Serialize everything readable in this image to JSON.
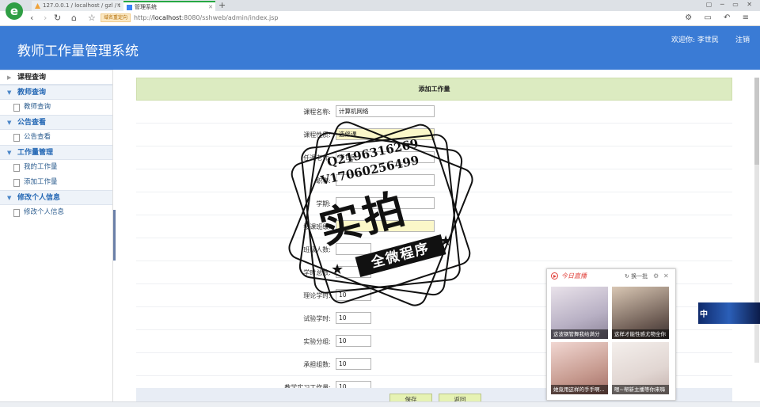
{
  "browser": {
    "tabs": [
      {
        "label": "127.0.0.1 / localhost / gzl / t"
      },
      {
        "label": "管理系统"
      }
    ],
    "new_tab": "+",
    "address_tag": "域名重定向",
    "address_scheme": "http://",
    "address_host": "localhost",
    "address_path": ":8080/sshweb/admin/index.jsp"
  },
  "header": {
    "title": "教师工作量管理系统",
    "welcome": "欢迎你: 李世民",
    "logout": "注销"
  },
  "sidebar": {
    "sections": [
      {
        "label": "课程查询",
        "items": []
      },
      {
        "label": "教师查询",
        "items": [
          {
            "label": "教师查询"
          }
        ]
      },
      {
        "label": "公告查看",
        "items": [
          {
            "label": "公告查看"
          }
        ]
      },
      {
        "label": "工作量管理",
        "items": [
          {
            "label": "我的工作量"
          },
          {
            "label": "添加工作量"
          }
        ]
      },
      {
        "label": "修改个人信息",
        "items": [
          {
            "label": "修改个人信息"
          }
        ]
      }
    ]
  },
  "form": {
    "title": "添加工作量",
    "fields": [
      {
        "label": "课程名称:",
        "value": "计算机网络"
      },
      {
        "label": "课程性质:",
        "value": "选修课"
      },
      {
        "label": "任课老师:",
        "value": "李世民"
      },
      {
        "label": "职称:",
        "value": ""
      },
      {
        "label": "学期:",
        "value": ""
      },
      {
        "label": "授课班级:",
        "value": ""
      },
      {
        "label": "班级人数:",
        "value": ""
      },
      {
        "label": "学时总数:",
        "value": ""
      },
      {
        "label": "理论学时:",
        "value": "10"
      },
      {
        "label": "试验学时:",
        "value": "10"
      },
      {
        "label": "实验分组:",
        "value": "10"
      },
      {
        "label": "承担组数:",
        "value": "10"
      },
      {
        "label": "教学实习工作量:",
        "value": "10"
      }
    ],
    "save_label": "保存",
    "back_label": "返回"
  },
  "watermark": {
    "qq": "Q2196316269",
    "wechat": "V17060256499",
    "big": "实拍",
    "band": "全微程序"
  },
  "live_popup": {
    "title": "今日直播",
    "swap_label": "换一批",
    "cards": [
      {
        "caption": "这波钢管舞我给满分"
      },
      {
        "caption": "这样才能性感尤物全你"
      },
      {
        "caption": "她竟用这样的手手啊..."
      },
      {
        "caption": "嗯~帮新主播等你来嗨"
      }
    ]
  },
  "side_ad": {
    "text": "中"
  }
}
